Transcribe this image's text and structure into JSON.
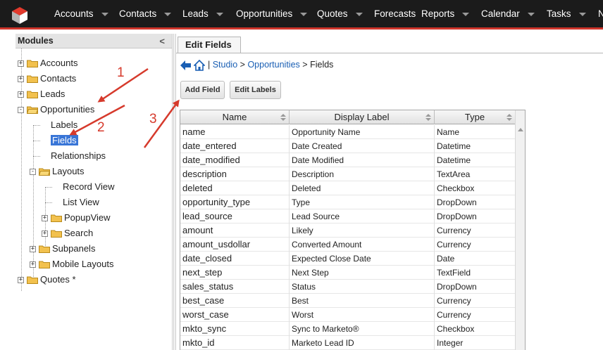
{
  "nav": {
    "items": [
      {
        "label": "Accounts",
        "has_caret": true
      },
      {
        "label": "Contacts",
        "has_caret": true
      },
      {
        "label": "Leads",
        "has_caret": true
      },
      {
        "label": "Opportunities",
        "has_caret": true
      },
      {
        "label": "Quotes",
        "has_caret": true
      },
      {
        "label": "Forecasts",
        "has_caret": false
      },
      {
        "label": "Reports",
        "has_caret": true
      },
      {
        "label": "Calendar",
        "has_caret": true
      },
      {
        "label": "Tasks",
        "has_caret": true
      },
      {
        "label": "N",
        "has_caret": false
      }
    ],
    "accent_color": "#d0352b",
    "logo_icon": "cube-logo-icon"
  },
  "modules": {
    "title": "Modules",
    "collapse_icon": "<",
    "tree": [
      {
        "label": "Accounts",
        "expander": "+",
        "icon": "folder-icon"
      },
      {
        "label": "Contacts",
        "expander": "+",
        "icon": "folder-icon"
      },
      {
        "label": "Leads",
        "expander": "+",
        "icon": "folder-icon"
      },
      {
        "label": "Opportunities",
        "expander": "-",
        "icon": "folder-open-icon"
      },
      {
        "label": "Labels"
      },
      {
        "label": "Fields",
        "selected": true
      },
      {
        "label": "Relationships"
      },
      {
        "label": "Layouts",
        "expander": "-",
        "icon": "folder-open-icon"
      },
      {
        "label": "Record View"
      },
      {
        "label": "List View"
      },
      {
        "label": "PopupView",
        "expander": "+",
        "icon": "folder-icon"
      },
      {
        "label": "Search",
        "expander": "+",
        "icon": "folder-icon"
      },
      {
        "label": "Subpanels",
        "expander": "+",
        "icon": "folder-icon"
      },
      {
        "label": "Mobile Layouts",
        "expander": "+",
        "icon": "folder-icon"
      },
      {
        "label": "Quotes *",
        "expander": "+",
        "icon": "folder-icon"
      }
    ]
  },
  "main": {
    "tab_label": "Edit Fields",
    "breadcrumb": {
      "separator": "|",
      "studio": "Studio",
      "arrow1": ">",
      "module": "Opportunities",
      "arrow2": ">",
      "current": "Fields"
    },
    "buttons": {
      "add_field": "Add Field",
      "edit_labels": "Edit Labels"
    },
    "grid": {
      "columns": [
        "Name",
        "Display Label",
        "Type"
      ],
      "rows": [
        [
          "name",
          "Opportunity Name",
          "Name"
        ],
        [
          "date_entered",
          "Date Created",
          "Datetime"
        ],
        [
          "date_modified",
          "Date Modified",
          "Datetime"
        ],
        [
          "description",
          "Description",
          "TextArea"
        ],
        [
          "deleted",
          "Deleted",
          "Checkbox"
        ],
        [
          "opportunity_type",
          "Type",
          "DropDown"
        ],
        [
          "lead_source",
          "Lead Source",
          "DropDown"
        ],
        [
          "amount",
          "Likely",
          "Currency"
        ],
        [
          "amount_usdollar",
          "Converted Amount",
          "Currency"
        ],
        [
          "date_closed",
          "Expected Close Date",
          "Date"
        ],
        [
          "next_step",
          "Next Step",
          "TextField"
        ],
        [
          "sales_status",
          "Status",
          "DropDown"
        ],
        [
          "best_case",
          "Best",
          "Currency"
        ],
        [
          "worst_case",
          "Worst",
          "Currency"
        ],
        [
          "mkto_sync",
          "Sync to Marketo®",
          "Checkbox"
        ],
        [
          "mkto_id",
          "Marketo Lead ID",
          "Integer"
        ]
      ]
    }
  },
  "annotations": [
    "1",
    "2",
    "3"
  ],
  "annotation_color": "#d63a2c"
}
